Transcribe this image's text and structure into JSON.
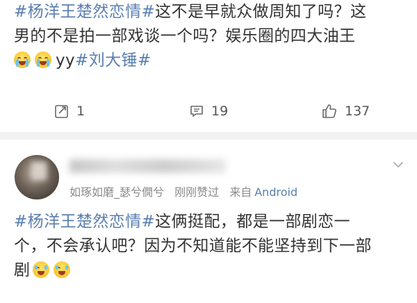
{
  "post1": {
    "hashtag": "#杨洋王楚然恋情#",
    "text_line1": "这不是早就众做周知了吗？这",
    "text_line2": "男的不是拍一部戏谈一个吗？娱乐圈的四大油王",
    "mention_prefix": "yy",
    "hashtag2": "#刘大锤#",
    "emojis": [
      "crying-emoji",
      "crying-emoji"
    ],
    "actions": {
      "share_count": "1",
      "comment_count": "19",
      "like_count": "137"
    }
  },
  "post2": {
    "username": "",
    "meta": {
      "nickname": "如琢如磨_瑟兮僩兮",
      "time": "刚刚赞过",
      "source_prefix": "来自",
      "source": "Android"
    },
    "hashtag": "#杨洋王楚然恋情#",
    "text_line1": "这俩挺配，都是一部剧恋一",
    "text_line2": "个，不会承认吧？因为不知道能不能坚持到下一部",
    "text_line3": "剧",
    "emojis": [
      "laughing-emoji",
      "laughing-emoji"
    ]
  },
  "colors": {
    "link": "#5a7fb0",
    "text": "#333333",
    "meta": "#8a8a8a",
    "divider": "#f2f2f2"
  },
  "icons": {
    "share": "share-icon",
    "comment": "comment-icon",
    "like": "like-icon",
    "more": "chevron-down-icon"
  }
}
